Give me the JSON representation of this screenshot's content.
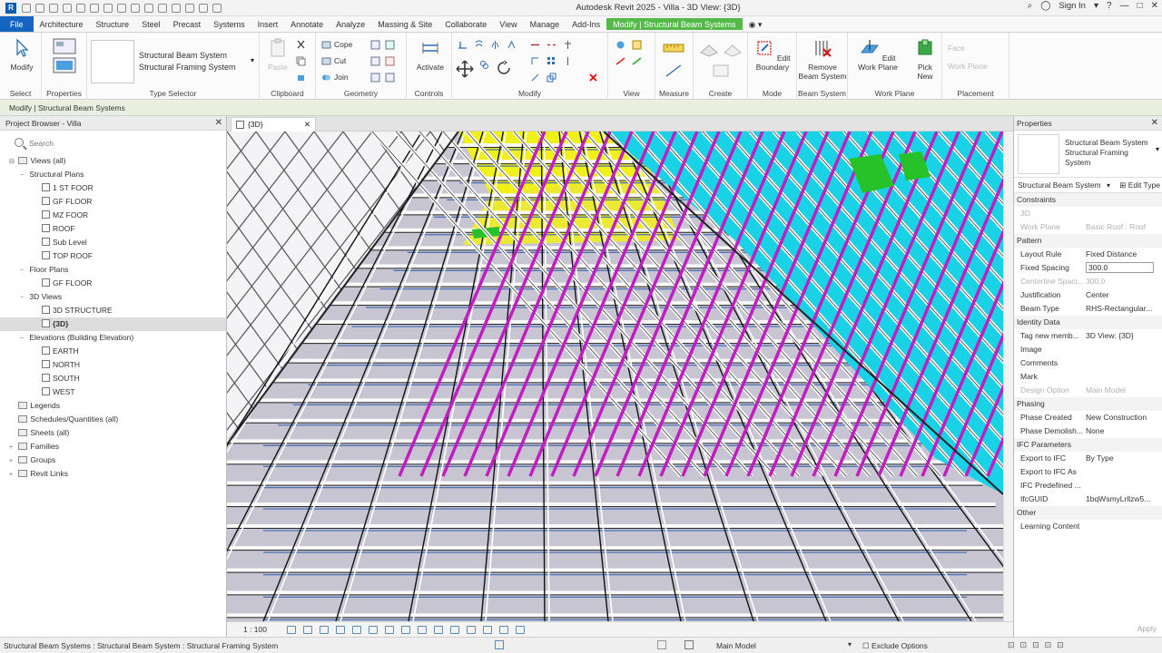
{
  "window": {
    "app_logo": "R",
    "title": "Autodesk Revit 2025 - Villa - 3D View: {3D}",
    "sign_in": "Sign In"
  },
  "ribbon_tabs": [
    "File",
    "Architecture",
    "Structure",
    "Steel",
    "Precast",
    "Systems",
    "Insert",
    "Annotate",
    "Analyze",
    "Massing & Site",
    "Collaborate",
    "View",
    "Manage",
    "Add-Ins",
    "Modify | Structural Beam Systems"
  ],
  "ribbon": {
    "select": {
      "modify": "Modify",
      "label": "Select"
    },
    "properties": {
      "label": "Properties"
    },
    "type_selector": {
      "line1": "Structural Beam System",
      "line2": "Structural Framing System",
      "label": "Type Selector"
    },
    "clipboard": {
      "paste": "Paste",
      "label": "Clipboard"
    },
    "geometry": {
      "cope": "Cope",
      "cut": "Cut",
      "join": "Join",
      "label": "Geometry"
    },
    "controls": {
      "activate": "Activate",
      "label": "Controls"
    },
    "modify": {
      "label": "Modify"
    },
    "view": {
      "label": "View"
    },
    "measure": {
      "label": "Measure"
    },
    "create": {
      "label": "Create"
    },
    "mode": {
      "edit_boundary_1": "Edit",
      "edit_boundary_2": "Boundary",
      "label": "Mode"
    },
    "beam_system": {
      "remove_1": "Remove",
      "remove_2": "Beam System",
      "label": "Beam System"
    },
    "work_plane": {
      "edit_1": "Edit",
      "edit_2": "Work Plane",
      "label": "Work Plane"
    },
    "placement": {
      "pick_1": "Pick",
      "pick_2": "New",
      "face": "Face",
      "work_plane": "Work Plane",
      "label": "Placement"
    }
  },
  "options_bar": {
    "text": "Modify | Structural Beam Systems"
  },
  "browser": {
    "title": "Project Browser - Villa",
    "search_placeholder": "Search",
    "items": [
      {
        "label": "Views (all)",
        "level": 0,
        "toggle": "⊟",
        "kind": "root"
      },
      {
        "label": "Structural Plans",
        "level": 1,
        "toggle": "−"
      },
      {
        "label": "1 ST FOOR",
        "level": 2,
        "kind": "view"
      },
      {
        "label": "GF FLOOR",
        "level": 2,
        "kind": "view"
      },
      {
        "label": "MZ FOOR",
        "level": 2,
        "kind": "view"
      },
      {
        "label": "ROOF",
        "level": 2,
        "kind": "view"
      },
      {
        "label": "Sub Level",
        "level": 2,
        "kind": "view"
      },
      {
        "label": "TOP ROOF",
        "level": 2,
        "kind": "view"
      },
      {
        "label": "Floor Plans",
        "level": 1,
        "toggle": "−"
      },
      {
        "label": "GF FLOOR",
        "level": 2,
        "kind": "view"
      },
      {
        "label": "3D Views",
        "level": 1,
        "toggle": "−"
      },
      {
        "label": "3D STRUCTURE",
        "level": 2,
        "kind": "view"
      },
      {
        "label": "{3D}",
        "level": 2,
        "kind": "view",
        "selected": true,
        "bold": true
      },
      {
        "label": "Elevations (Building Elevation)",
        "level": 1,
        "toggle": "−"
      },
      {
        "label": "EARTH",
        "level": 2,
        "kind": "view"
      },
      {
        "label": "NORTH",
        "level": 2,
        "kind": "view"
      },
      {
        "label": "SOUTH",
        "level": 2,
        "kind": "view"
      },
      {
        "label": "WEST",
        "level": 2,
        "kind": "view"
      },
      {
        "label": "Legends",
        "level": 0,
        "kind": "folder"
      },
      {
        "label": "Schedules/Quantities (all)",
        "level": 0,
        "kind": "folder"
      },
      {
        "label": "Sheets (all)",
        "level": 0,
        "kind": "folder"
      },
      {
        "label": "Families",
        "level": 0,
        "toggle": "+",
        "kind": "folder"
      },
      {
        "label": "Groups",
        "level": 0,
        "toggle": "+",
        "kind": "folder"
      },
      {
        "label": "Revit Links",
        "level": 0,
        "toggle": "+",
        "kind": "folder"
      }
    ]
  },
  "view": {
    "tab": "{3D}",
    "scale": "1 : 100"
  },
  "colors": {
    "roof_purple": "#c8c5d2",
    "cyan": "#1ad2e6",
    "magenta": "#c21dc2",
    "yellow": "#f0f01a",
    "green": "#27c22a",
    "accent": "#54b948"
  },
  "properties": {
    "title": "Properties",
    "type_line1": "Structural Beam System",
    "type_line2": "Structural Framing",
    "type_line3": "System",
    "selector": "Structural Beam System",
    "edit_type": "Edit Type",
    "rows": [
      {
        "group": "Constraints"
      },
      {
        "k": "3D",
        "v": "",
        "disabled": true
      },
      {
        "k": "Work Plane",
        "v": "Basic Roof : Roof",
        "disabled": true
      },
      {
        "group": "Pattern"
      },
      {
        "k": "Layout Rule",
        "v": "Fixed Distance"
      },
      {
        "k": "Fixed Spacing",
        "v": "300.0",
        "input": true
      },
      {
        "k": "Centerline Spaci...",
        "v": "300.0",
        "disabled": true
      },
      {
        "k": "Justification",
        "v": "Center"
      },
      {
        "k": "Beam Type",
        "v": "RHS-Rectangular..."
      },
      {
        "group": "Identity Data"
      },
      {
        "k": "Tag new memb...",
        "v": "3D View: {3D}"
      },
      {
        "k": "Image",
        "v": ""
      },
      {
        "k": "Comments",
        "v": ""
      },
      {
        "k": "Mark",
        "v": ""
      },
      {
        "k": "Design Option",
        "v": "Main Model",
        "disabled": true
      },
      {
        "group": "Phasing"
      },
      {
        "k": "Phase Created",
        "v": "New Construction"
      },
      {
        "k": "Phase Demolish...",
        "v": "None"
      },
      {
        "group": "IFC Parameters"
      },
      {
        "k": "Export to IFC",
        "v": "By Type"
      },
      {
        "k": "Export to IFC As",
        "v": ""
      },
      {
        "k": "IFC Predefined ...",
        "v": ""
      },
      {
        "k": "IfcGUID",
        "v": "1bqWsmyLrllzw5..."
      },
      {
        "group": "Other"
      },
      {
        "k": "Learning Content",
        "v": ""
      }
    ],
    "apply": "Apply"
  },
  "status": {
    "message": "Structural Beam Systems : Structural Beam System : Structural Framing System",
    "model": "Main Model",
    "exclude": "Exclude Options"
  }
}
